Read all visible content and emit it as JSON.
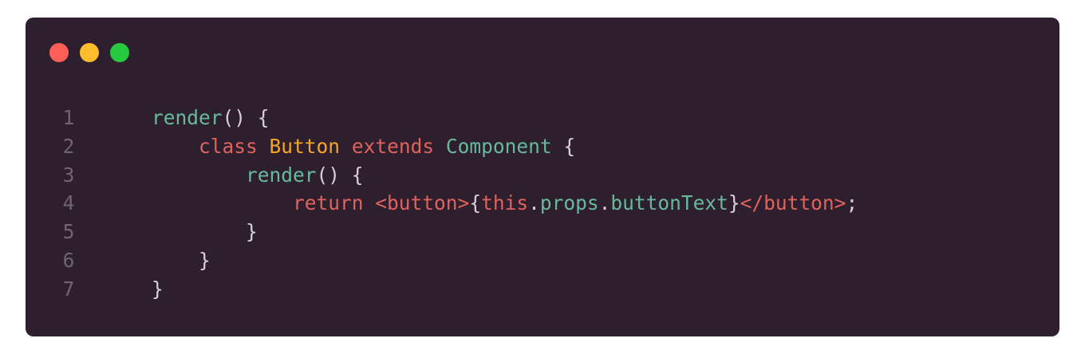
{
  "window": {
    "controls": {
      "close_color": "#ff5f56",
      "minimize_color": "#ffbd2e",
      "zoom_color": "#27c93f"
    }
  },
  "code": {
    "lines": [
      {
        "number": "1",
        "tokens": [
          {
            "text": "render",
            "type": "fn"
          },
          {
            "text": "() {",
            "type": "punct"
          }
        ]
      },
      {
        "number": "2",
        "tokens": [
          {
            "text": "    ",
            "type": "plain"
          },
          {
            "text": "class",
            "type": "kw"
          },
          {
            "text": " ",
            "type": "plain"
          },
          {
            "text": "Button",
            "type": "cls"
          },
          {
            "text": " ",
            "type": "plain"
          },
          {
            "text": "extends",
            "type": "kw"
          },
          {
            "text": " ",
            "type": "plain"
          },
          {
            "text": "Component",
            "type": "fn"
          },
          {
            "text": " {",
            "type": "punct"
          }
        ]
      },
      {
        "number": "3",
        "tokens": [
          {
            "text": "        ",
            "type": "plain"
          },
          {
            "text": "render",
            "type": "fn"
          },
          {
            "text": "() {",
            "type": "punct"
          }
        ]
      },
      {
        "number": "4",
        "tokens": [
          {
            "text": "            ",
            "type": "plain"
          },
          {
            "text": "return",
            "type": "kw"
          },
          {
            "text": " ",
            "type": "plain"
          },
          {
            "text": "<button>",
            "type": "tag"
          },
          {
            "text": "{",
            "type": "punct"
          },
          {
            "text": "this",
            "type": "kw"
          },
          {
            "text": ".",
            "type": "punct"
          },
          {
            "text": "props",
            "type": "fn"
          },
          {
            "text": ".",
            "type": "punct"
          },
          {
            "text": "buttonText",
            "type": "fn"
          },
          {
            "text": "}",
            "type": "punct"
          },
          {
            "text": "</button>",
            "type": "tag"
          },
          {
            "text": ";",
            "type": "punct"
          }
        ]
      },
      {
        "number": "5",
        "tokens": [
          {
            "text": "        ",
            "type": "plain"
          },
          {
            "text": "}",
            "type": "punct"
          }
        ]
      },
      {
        "number": "6",
        "tokens": [
          {
            "text": "    ",
            "type": "plain"
          },
          {
            "text": "}",
            "type": "punct"
          }
        ]
      },
      {
        "number": "7",
        "tokens": [
          {
            "text": "}",
            "type": "punct"
          }
        ]
      }
    ]
  }
}
